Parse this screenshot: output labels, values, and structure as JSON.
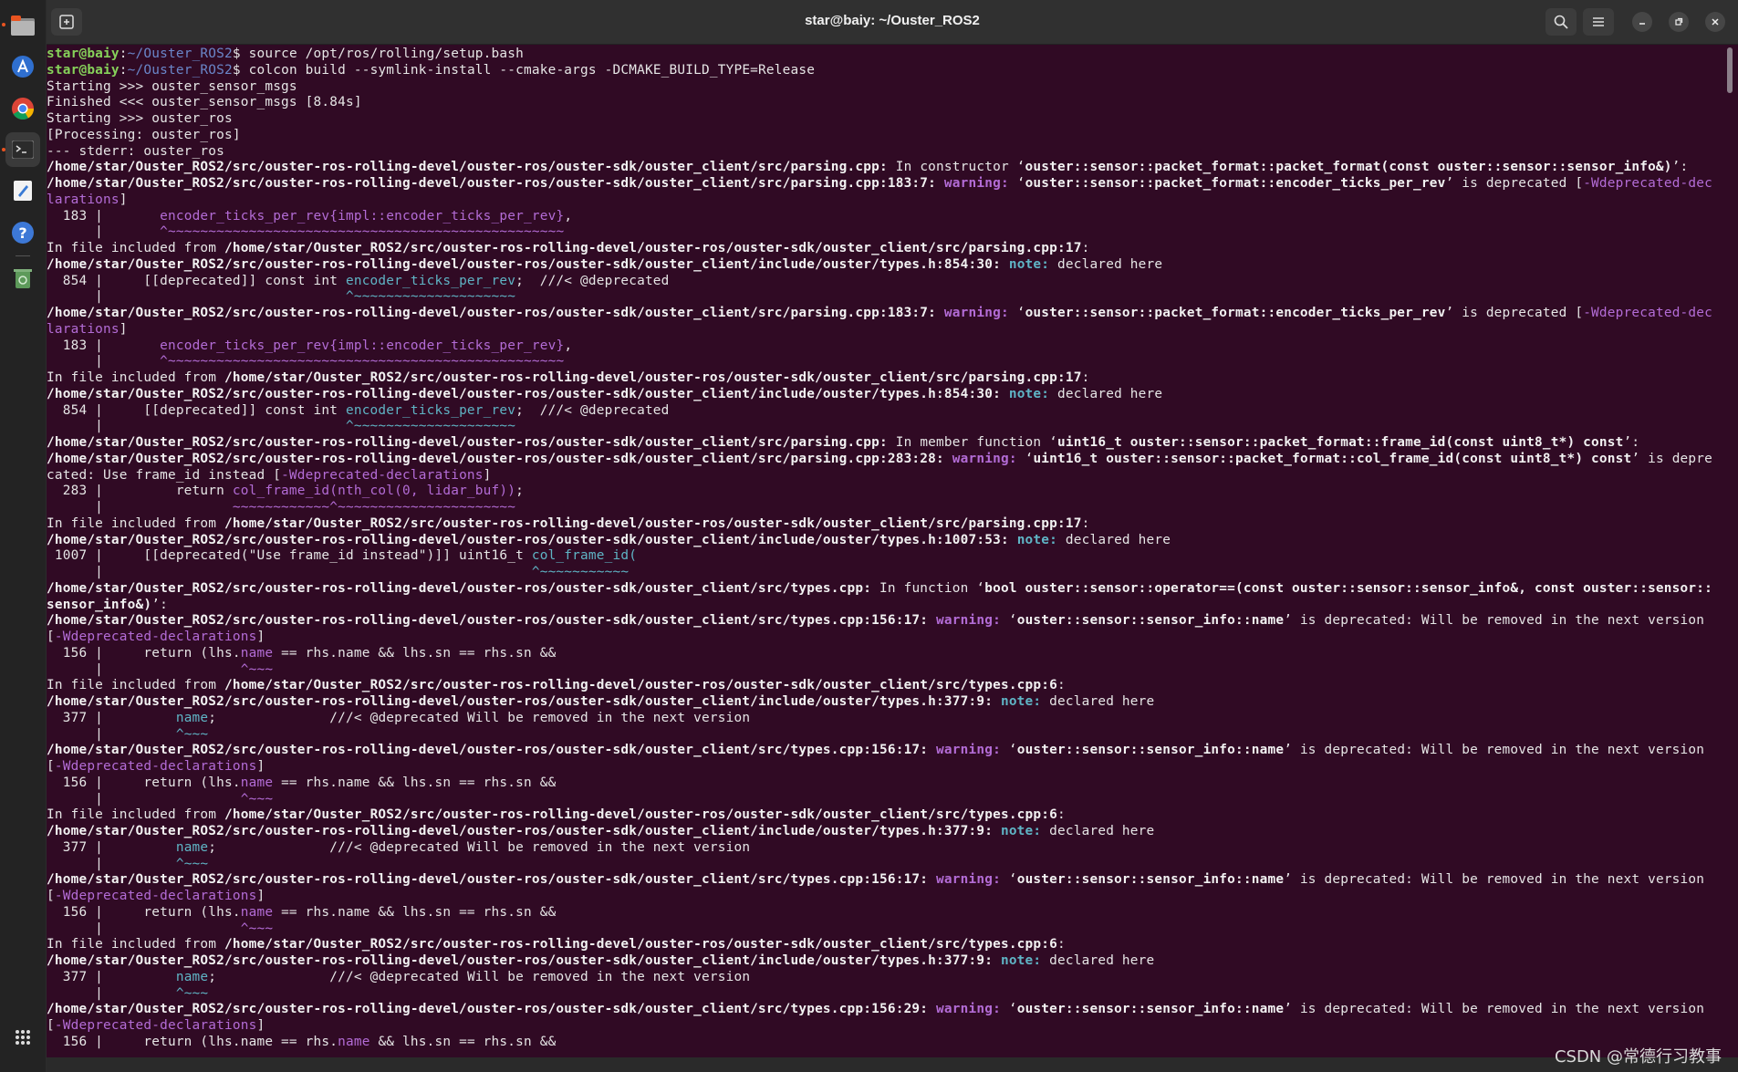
{
  "window": {
    "title": "star@baiy: ~/Ouster_ROS2"
  },
  "headerbar": {
    "new_tab_icon": "new-tab-icon",
    "search_icon": "search-icon",
    "menu_icon": "hamburger-menu-icon",
    "minimize_icon": "minimize-icon",
    "maximize_icon": "maximize-icon",
    "close_icon": "close-icon"
  },
  "dock": {
    "items": [
      "files-icon",
      "software-store-icon",
      "chrome-icon",
      "terminal-icon",
      "text-editor-icon",
      "help-icon",
      "trash-icon"
    ],
    "apps_grid": "show-apps-icon"
  },
  "colors": {
    "terminal_bg": "#300a24",
    "prompt_user": "#86d15a",
    "prompt_path": "#6a86c9",
    "warning": "#b36cd6",
    "note": "#5fb4c5"
  },
  "terminal": {
    "lines": [
      [
        {
          "t": "star@baiy",
          "c": "gr"
        },
        {
          "t": ":"
        },
        {
          "t": "~/Ouster_ROS2",
          "c": "bl"
        },
        {
          "t": "$ source /opt/ros/rolling/setup.bash"
        }
      ],
      [
        {
          "t": "star@baiy",
          "c": "gr"
        },
        {
          "t": ":"
        },
        {
          "t": "~/Ouster_ROS2",
          "c": "bl"
        },
        {
          "t": "$ colcon build --symlink-install --cmake-args -DCMAKE_BUILD_TYPE=Release"
        }
      ],
      [
        {
          "t": "Starting >>> ouster_sensor_msgs"
        }
      ],
      [
        {
          "t": "Finished <<< ouster_sensor_msgs [8.84s]"
        }
      ],
      [
        {
          "t": "Starting >>> ouster_ros"
        }
      ],
      [
        {
          "t": "[Processing: ouster_ros]"
        }
      ],
      [
        {
          "t": "--- stderr: ouster_ros"
        }
      ],
      [
        {
          "t": "/home/star/Ouster_ROS2/src/ouster-ros-rolling-devel/ouster-ros/ouster-sdk/ouster_client/src/parsing.cpp:",
          "c": "b"
        },
        {
          "t": " In constructor ‘"
        },
        {
          "t": "ouster::sensor::packet_format::packet_format(const ouster::sensor::sensor_info&)",
          "c": "b"
        },
        {
          "t": "’:"
        }
      ],
      [
        {
          "t": "/home/star/Ouster_ROS2/src/ouster-ros-rolling-devel/ouster-ros/ouster-sdk/ouster_client/src/parsing.cpp:183:7:",
          "c": "b"
        },
        {
          "t": " "
        },
        {
          "t": "warning:",
          "c": "pub"
        },
        {
          "t": " ‘"
        },
        {
          "t": "ouster::sensor::packet_format::encoder_ticks_per_rev",
          "c": "b"
        },
        {
          "t": "’ is deprecated ["
        },
        {
          "t": "-Wdeprecated-dec",
          "c": "pu"
        }
      ],
      [
        {
          "t": "larations",
          "c": "pu"
        },
        {
          "t": "]"
        }
      ],
      [
        {
          "t": "  183 |       "
        },
        {
          "t": "encoder_ticks_per_rev{impl::encoder_ticks_per_rev}",
          "c": "pu"
        },
        {
          "t": ","
        }
      ],
      [
        {
          "t": "      |       "
        },
        {
          "t": "^~~~~~~~~~~~~~~~~~~~~~~~~~~~~~~~~~~~~~~~~~~~~~~~~~",
          "c": "pu"
        }
      ],
      [
        {
          "t": "In file included from "
        },
        {
          "t": "/home/star/Ouster_ROS2/src/ouster-ros-rolling-devel/ouster-ros/ouster-sdk/ouster_client/src/parsing.cpp:17",
          "c": "b"
        },
        {
          "t": ":"
        }
      ],
      [
        {
          "t": "/home/star/Ouster_ROS2/src/ouster-ros-rolling-devel/ouster-ros/ouster-sdk/ouster_client/include/ouster/types.h:854:30:",
          "c": "b"
        },
        {
          "t": " "
        },
        {
          "t": "note:",
          "c": "cyb"
        },
        {
          "t": " declared here"
        }
      ],
      [
        {
          "t": "  854 |     [[deprecated]] const int "
        },
        {
          "t": "encoder_ticks_per_rev",
          "c": "cy"
        },
        {
          "t": ";  ///< @deprecated"
        }
      ],
      [
        {
          "t": "      |                              "
        },
        {
          "t": "^~~~~~~~~~~~~~~~~~~~~",
          "c": "cy"
        }
      ],
      [
        {
          "t": "/home/star/Ouster_ROS2/src/ouster-ros-rolling-devel/ouster-ros/ouster-sdk/ouster_client/src/parsing.cpp:183:7:",
          "c": "b"
        },
        {
          "t": " "
        },
        {
          "t": "warning:",
          "c": "pub"
        },
        {
          "t": " ‘"
        },
        {
          "t": "ouster::sensor::packet_format::encoder_ticks_per_rev",
          "c": "b"
        },
        {
          "t": "’ is deprecated ["
        },
        {
          "t": "-Wdeprecated-dec",
          "c": "pu"
        }
      ],
      [
        {
          "t": "larations",
          "c": "pu"
        },
        {
          "t": "]"
        }
      ],
      [
        {
          "t": "  183 |       "
        },
        {
          "t": "encoder_ticks_per_rev{impl::encoder_ticks_per_rev}",
          "c": "pu"
        },
        {
          "t": ","
        }
      ],
      [
        {
          "t": "      |       "
        },
        {
          "t": "^~~~~~~~~~~~~~~~~~~~~~~~~~~~~~~~~~~~~~~~~~~~~~~~~~",
          "c": "pu"
        }
      ],
      [
        {
          "t": "In file included from "
        },
        {
          "t": "/home/star/Ouster_ROS2/src/ouster-ros-rolling-devel/ouster-ros/ouster-sdk/ouster_client/src/parsing.cpp:17",
          "c": "b"
        },
        {
          "t": ":"
        }
      ],
      [
        {
          "t": "/home/star/Ouster_ROS2/src/ouster-ros-rolling-devel/ouster-ros/ouster-sdk/ouster_client/include/ouster/types.h:854:30:",
          "c": "b"
        },
        {
          "t": " "
        },
        {
          "t": "note:",
          "c": "cyb"
        },
        {
          "t": " declared here"
        }
      ],
      [
        {
          "t": "  854 |     [[deprecated]] const int "
        },
        {
          "t": "encoder_ticks_per_rev",
          "c": "cy"
        },
        {
          "t": ";  ///< @deprecated"
        }
      ],
      [
        {
          "t": "      |                              "
        },
        {
          "t": "^~~~~~~~~~~~~~~~~~~~~",
          "c": "cy"
        }
      ],
      [
        {
          "t": "/home/star/Ouster_ROS2/src/ouster-ros-rolling-devel/ouster-ros/ouster-sdk/ouster_client/src/parsing.cpp:",
          "c": "b"
        },
        {
          "t": " In member function ‘"
        },
        {
          "t": "uint16_t ouster::sensor::packet_format::frame_id(const uint8_t*) const",
          "c": "b"
        },
        {
          "t": "’:"
        }
      ],
      [
        {
          "t": "/home/star/Ouster_ROS2/src/ouster-ros-rolling-devel/ouster-ros/ouster-sdk/ouster_client/src/parsing.cpp:283:28:",
          "c": "b"
        },
        {
          "t": " "
        },
        {
          "t": "warning:",
          "c": "pub"
        },
        {
          "t": " ‘"
        },
        {
          "t": "uint16_t ouster::sensor::packet_format::col_frame_id(const uint8_t*) const",
          "c": "b"
        },
        {
          "t": "’ is depre"
        }
      ],
      [
        {
          "t": "cated: Use frame_id instead ["
        },
        {
          "t": "-Wdeprecated-declarations",
          "c": "pu"
        },
        {
          "t": "]"
        }
      ],
      [
        {
          "t": "  283 |         return "
        },
        {
          "t": "col_frame_id(nth_col(0, lidar_buf))",
          "c": "pu"
        },
        {
          "t": ";"
        }
      ],
      [
        {
          "t": "      |                "
        },
        {
          "t": "~~~~~~~~~~~~^~~~~~~~~~~~~~~~~~~~~~~",
          "c": "pu"
        }
      ],
      [
        {
          "t": "In file included from "
        },
        {
          "t": "/home/star/Ouster_ROS2/src/ouster-ros-rolling-devel/ouster-ros/ouster-sdk/ouster_client/src/parsing.cpp:17",
          "c": "b"
        },
        {
          "t": ":"
        }
      ],
      [
        {
          "t": "/home/star/Ouster_ROS2/src/ouster-ros-rolling-devel/ouster-ros/ouster-sdk/ouster_client/include/ouster/types.h:1007:53:",
          "c": "b"
        },
        {
          "t": " "
        },
        {
          "t": "note:",
          "c": "cyb"
        },
        {
          "t": " declared here"
        }
      ],
      [
        {
          "t": " 1007 |     [[deprecated(\"Use frame_id instead\")]] uint16_t "
        },
        {
          "t": "col_frame_id(",
          "c": "cy"
        }
      ],
      [
        {
          "t": "      |                                                     "
        },
        {
          "t": "^~~~~~~~~~~~",
          "c": "cy"
        }
      ],
      [
        {
          "t": "/home/star/Ouster_ROS2/src/ouster-ros-rolling-devel/ouster-ros/ouster-sdk/ouster_client/src/types.cpp:",
          "c": "b"
        },
        {
          "t": " In function ‘"
        },
        {
          "t": "bool ouster::sensor::operator==(const ouster::sensor::sensor_info&, const ouster::sensor::",
          "c": "b"
        }
      ],
      [
        {
          "t": "sensor_info&)",
          "c": "b"
        },
        {
          "t": "’:"
        }
      ],
      [
        {
          "t": "/home/star/Ouster_ROS2/src/ouster-ros-rolling-devel/ouster-ros/ouster-sdk/ouster_client/src/types.cpp:156:17:",
          "c": "b"
        },
        {
          "t": " "
        },
        {
          "t": "warning:",
          "c": "pub"
        },
        {
          "t": " ‘"
        },
        {
          "t": "ouster::sensor::sensor_info::name",
          "c": "b"
        },
        {
          "t": "’ is deprecated: Will be removed in the next version"
        }
      ],
      [
        {
          "t": "["
        },
        {
          "t": "-Wdeprecated-declarations",
          "c": "pu"
        },
        {
          "t": "]"
        }
      ],
      [
        {
          "t": "  156 |     return (lhs."
        },
        {
          "t": "name",
          "c": "pu"
        },
        {
          "t": " == rhs.name && lhs.sn == rhs.sn &&"
        }
      ],
      [
        {
          "t": "      |                 "
        },
        {
          "t": "^~~~",
          "c": "pu"
        }
      ],
      [
        {
          "t": "In file included from "
        },
        {
          "t": "/home/star/Ouster_ROS2/src/ouster-ros-rolling-devel/ouster-ros/ouster-sdk/ouster_client/src/types.cpp:6",
          "c": "b"
        },
        {
          "t": ":"
        }
      ],
      [
        {
          "t": "/home/star/Ouster_ROS2/src/ouster-ros-rolling-devel/ouster-ros/ouster-sdk/ouster_client/include/ouster/types.h:377:9:",
          "c": "b"
        },
        {
          "t": " "
        },
        {
          "t": "note:",
          "c": "cyb"
        },
        {
          "t": " declared here"
        }
      ],
      [
        {
          "t": "  377 |         "
        },
        {
          "t": "name",
          "c": "cy"
        },
        {
          "t": ";              ///< @deprecated Will be removed in the next version"
        }
      ],
      [
        {
          "t": "      |         "
        },
        {
          "t": "^~~~",
          "c": "cy"
        }
      ],
      [
        {
          "t": "/home/star/Ouster_ROS2/src/ouster-ros-rolling-devel/ouster-ros/ouster-sdk/ouster_client/src/types.cpp:156:17:",
          "c": "b"
        },
        {
          "t": " "
        },
        {
          "t": "warning:",
          "c": "pub"
        },
        {
          "t": " ‘"
        },
        {
          "t": "ouster::sensor::sensor_info::name",
          "c": "b"
        },
        {
          "t": "’ is deprecated: Will be removed in the next version"
        }
      ],
      [
        {
          "t": "["
        },
        {
          "t": "-Wdeprecated-declarations",
          "c": "pu"
        },
        {
          "t": "]"
        }
      ],
      [
        {
          "t": "  156 |     return (lhs."
        },
        {
          "t": "name",
          "c": "pu"
        },
        {
          "t": " == rhs.name && lhs.sn == rhs.sn &&"
        }
      ],
      [
        {
          "t": "      |                 "
        },
        {
          "t": "^~~~",
          "c": "pu"
        }
      ],
      [
        {
          "t": "In file included from "
        },
        {
          "t": "/home/star/Ouster_ROS2/src/ouster-ros-rolling-devel/ouster-ros/ouster-sdk/ouster_client/src/types.cpp:6",
          "c": "b"
        },
        {
          "t": ":"
        }
      ],
      [
        {
          "t": "/home/star/Ouster_ROS2/src/ouster-ros-rolling-devel/ouster-ros/ouster-sdk/ouster_client/include/ouster/types.h:377:9:",
          "c": "b"
        },
        {
          "t": " "
        },
        {
          "t": "note:",
          "c": "cyb"
        },
        {
          "t": " declared here"
        }
      ],
      [
        {
          "t": "  377 |         "
        },
        {
          "t": "name",
          "c": "cy"
        },
        {
          "t": ";              ///< @deprecated Will be removed in the next version"
        }
      ],
      [
        {
          "t": "      |         "
        },
        {
          "t": "^~~~",
          "c": "cy"
        }
      ],
      [
        {
          "t": "/home/star/Ouster_ROS2/src/ouster-ros-rolling-devel/ouster-ros/ouster-sdk/ouster_client/src/types.cpp:156:17:",
          "c": "b"
        },
        {
          "t": " "
        },
        {
          "t": "warning:",
          "c": "pub"
        },
        {
          "t": " ‘"
        },
        {
          "t": "ouster::sensor::sensor_info::name",
          "c": "b"
        },
        {
          "t": "’ is deprecated: Will be removed in the next version"
        }
      ],
      [
        {
          "t": "["
        },
        {
          "t": "-Wdeprecated-declarations",
          "c": "pu"
        },
        {
          "t": "]"
        }
      ],
      [
        {
          "t": "  156 |     return (lhs."
        },
        {
          "t": "name",
          "c": "pu"
        },
        {
          "t": " == rhs.name && lhs.sn == rhs.sn &&"
        }
      ],
      [
        {
          "t": "      |                 "
        },
        {
          "t": "^~~~",
          "c": "pu"
        }
      ],
      [
        {
          "t": "In file included from "
        },
        {
          "t": "/home/star/Ouster_ROS2/src/ouster-ros-rolling-devel/ouster-ros/ouster-sdk/ouster_client/src/types.cpp:6",
          "c": "b"
        },
        {
          "t": ":"
        }
      ],
      [
        {
          "t": "/home/star/Ouster_ROS2/src/ouster-ros-rolling-devel/ouster-ros/ouster-sdk/ouster_client/include/ouster/types.h:377:9:",
          "c": "b"
        },
        {
          "t": " "
        },
        {
          "t": "note:",
          "c": "cyb"
        },
        {
          "t": " declared here"
        }
      ],
      [
        {
          "t": "  377 |         "
        },
        {
          "t": "name",
          "c": "cy"
        },
        {
          "t": ";              ///< @deprecated Will be removed in the next version"
        }
      ],
      [
        {
          "t": "      |         "
        },
        {
          "t": "^~~~",
          "c": "cy"
        }
      ],
      [
        {
          "t": "/home/star/Ouster_ROS2/src/ouster-ros-rolling-devel/ouster-ros/ouster-sdk/ouster_client/src/types.cpp:156:29:",
          "c": "b"
        },
        {
          "t": " "
        },
        {
          "t": "warning:",
          "c": "pub"
        },
        {
          "t": " ‘"
        },
        {
          "t": "ouster::sensor::sensor_info::name",
          "c": "b"
        },
        {
          "t": "’ is deprecated: Will be removed in the next version"
        }
      ],
      [
        {
          "t": "["
        },
        {
          "t": "-Wdeprecated-declarations",
          "c": "pu"
        },
        {
          "t": "]"
        }
      ],
      [
        {
          "t": "  156 |     return (lhs.name == rhs."
        },
        {
          "t": "name",
          "c": "pu"
        },
        {
          "t": " && lhs.sn == rhs.sn &&"
        }
      ]
    ]
  },
  "watermark": "CSDN @常德行习教事"
}
